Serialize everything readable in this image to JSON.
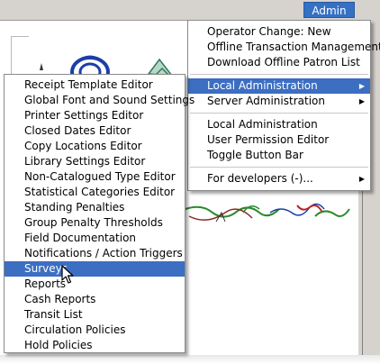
{
  "header": {
    "admin_label": "Admin (-)"
  },
  "admin_menu": {
    "group1": [
      {
        "label": "Operator Change: New",
        "submenu": false
      },
      {
        "label": "Offline Transaction Management",
        "submenu": false
      },
      {
        "label": "Download Offline Patron List",
        "submenu": false
      }
    ],
    "group2": [
      {
        "label": "Local Administration",
        "submenu": true,
        "highlighted": true
      },
      {
        "label": "Server Administration",
        "submenu": true
      }
    ],
    "group3": [
      {
        "label": "Local Administration",
        "submenu": false
      },
      {
        "label": "User Permission Editor",
        "submenu": false
      },
      {
        "label": "Toggle Button Bar",
        "submenu": false
      }
    ],
    "group4": [
      {
        "label": "For developers (-)...",
        "submenu": true
      }
    ]
  },
  "local_admin_menu": {
    "items": [
      {
        "label": "Receipt Template Editor"
      },
      {
        "label": "Global Font and Sound Settings"
      },
      {
        "label": "Printer Settings Editor"
      },
      {
        "label": "Closed Dates Editor"
      },
      {
        "label": "Copy Locations Editor"
      },
      {
        "label": "Library Settings Editor"
      },
      {
        "label": "Non-Catalogued Type Editor"
      },
      {
        "label": "Statistical Categories Editor"
      },
      {
        "label": "Standing Penalties"
      },
      {
        "label": "Group Penalty Thresholds"
      },
      {
        "label": "Field Documentation"
      },
      {
        "label": "Notifications / Action Triggers"
      },
      {
        "label": "Surveys",
        "highlighted": true
      },
      {
        "label": "Reports"
      },
      {
        "label": "Cash Reports"
      },
      {
        "label": "Transit List"
      },
      {
        "label": "Circulation Policies"
      },
      {
        "label": "Hold Policies"
      }
    ]
  },
  "colors": {
    "highlight": "#3c6ec2",
    "admin_button": "#3470c4",
    "menu_border": "#8a8a8a"
  },
  "icons": {
    "submenu_arrow": "triangle-right-icon",
    "cursor": "mouse-pointer-icon"
  }
}
